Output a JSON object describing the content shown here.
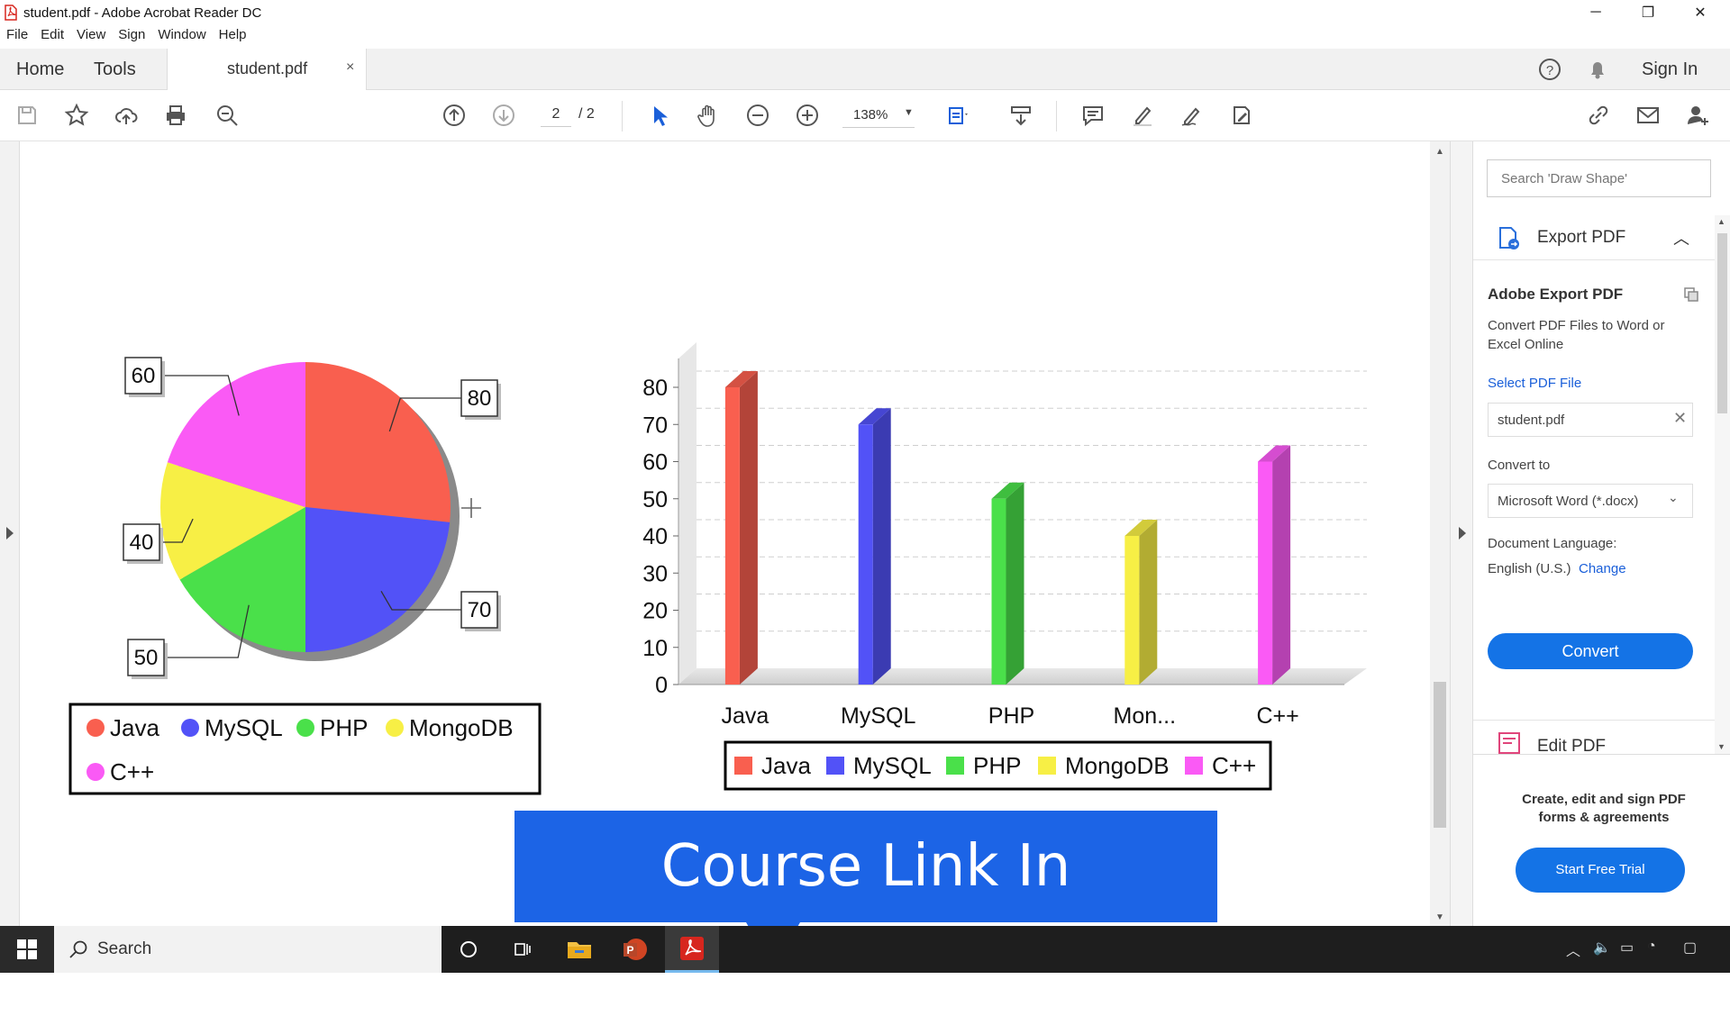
{
  "window": {
    "title": "student.pdf - Adobe Acrobat Reader DC",
    "minimize": "─",
    "restore": "❐",
    "close": "✕"
  },
  "menu": [
    "File",
    "Edit",
    "View",
    "Sign",
    "Window",
    "Help"
  ],
  "tabs": {
    "home": "Home",
    "tools": "Tools",
    "document": "student.pdf",
    "close": "×",
    "sign_in": "Sign In"
  },
  "toolbar": {
    "page_current": "2",
    "page_total": "/ 2",
    "zoom": "138%"
  },
  "document": {
    "pie_chart": {
      "slices": [
        {
          "label": "Java",
          "value": 80,
          "color": "#f95f4f"
        },
        {
          "label": "MySQL",
          "value": 70,
          "color": "#5252f7"
        },
        {
          "label": "PHP",
          "value": 50,
          "color": "#4ae04a"
        },
        {
          "label": "MongoDB",
          "value": 40,
          "color": "#f7ef45"
        },
        {
          "label": "C++",
          "value": 60,
          "color": "#fa5af5"
        }
      ]
    },
    "bar_chart": {
      "categories": [
        "Java",
        "MySQL",
        "PHP",
        "Mon...",
        "C++"
      ],
      "y_ticks": [
        "0",
        "10",
        "20",
        "30",
        "40",
        "50",
        "60",
        "70",
        "80"
      ]
    },
    "legend": [
      {
        "label": "Java",
        "color": "#f95f4f"
      },
      {
        "label": "MySQL",
        "color": "#5252f7"
      },
      {
        "label": "PHP",
        "color": "#4ae04a"
      },
      {
        "label": "MongoDB",
        "color": "#f7ef45"
      },
      {
        "label": "C++",
        "color": "#fa5af5"
      }
    ]
  },
  "chart_data": [
    {
      "type": "pie",
      "categories": [
        "Java",
        "MySQL",
        "PHP",
        "MongoDB",
        "C++"
      ],
      "values": [
        80,
        70,
        50,
        40,
        60
      ],
      "legend_position": "bottom"
    },
    {
      "type": "bar",
      "categories": [
        "Java",
        "MySQL",
        "PHP",
        "MongoDB",
        "C++"
      ],
      "values": [
        80,
        70,
        50,
        40,
        60
      ],
      "ylim": [
        0,
        80
      ],
      "grid": true,
      "legend_position": "bottom"
    }
  ],
  "right_pane": {
    "search_placeholder": "Search 'Draw Shape'",
    "export_pdf": "Export PDF",
    "adobe_export_title": "Adobe Export PDF",
    "adobe_export_desc": "Convert PDF Files to Word or Excel Online",
    "select_file_label": "Select PDF File",
    "file_name": "student.pdf",
    "convert_to_label": "Convert to",
    "convert_to_value": "Microsoft Word (*.docx)",
    "doc_language_label": "Document Language:",
    "doc_language_value": "English (U.S.)",
    "change_link": "Change",
    "convert_button": "Convert",
    "edit_pdf": "Edit PDF",
    "promo_text": "Create, edit and sign PDF forms & agreements",
    "trial_button": "Start Free Trial"
  },
  "banner": {
    "text": "Course Link In Description"
  },
  "taskbar": {
    "search": "Search"
  }
}
